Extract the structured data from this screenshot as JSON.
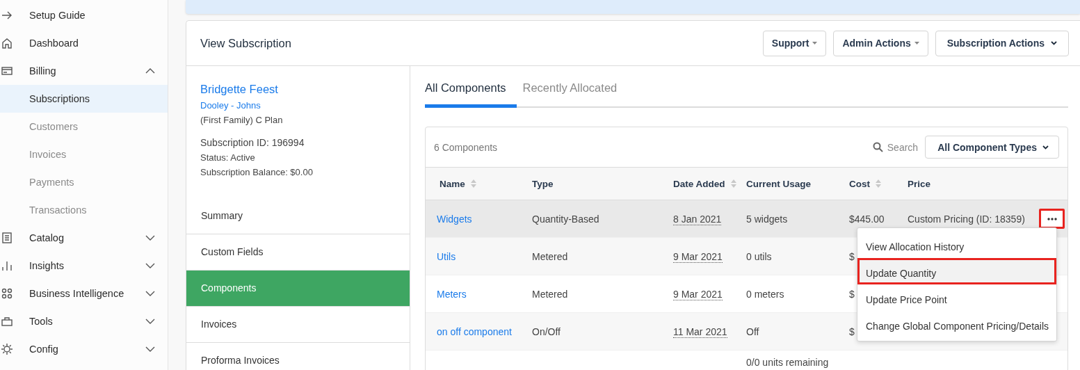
{
  "sidebar": {
    "items": [
      {
        "label": "Setup Guide"
      },
      {
        "label": "Dashboard"
      },
      {
        "label": "Billing",
        "expanded": true,
        "children": [
          {
            "label": "Subscriptions",
            "selected": true
          },
          {
            "label": "Customers",
            "selected": false
          },
          {
            "label": "Invoices",
            "selected": false
          },
          {
            "label": "Payments",
            "selected": false
          },
          {
            "label": "Transactions",
            "selected": false
          }
        ]
      },
      {
        "label": "Catalog",
        "expanded": false
      },
      {
        "label": "Insights",
        "expanded": false
      },
      {
        "label": "Business Intelligence",
        "expanded": false
      },
      {
        "label": "Tools",
        "expanded": false
      },
      {
        "label": "Config",
        "expanded": false
      }
    ]
  },
  "page": {
    "title": "View Subscription",
    "buttons": [
      "Support",
      "Admin Actions",
      "Subscription Actions"
    ]
  },
  "customer": {
    "name": "Bridgette Feest",
    "company": "Dooley - Johns",
    "plan": "(First Family) C Plan",
    "subscription_id": "Subscription ID: 196994",
    "status": "Status: Active",
    "balance": "Subscription Balance: $0.00"
  },
  "subscription_nav": [
    {
      "label": "Summary",
      "selected": false
    },
    {
      "label": "Custom Fields",
      "selected": false
    },
    {
      "label": "Components",
      "selected": true
    },
    {
      "label": "Invoices",
      "selected": false
    },
    {
      "label": "Proforma Invoices",
      "selected": false
    }
  ],
  "tabs": [
    {
      "label": "All Components",
      "selected": true
    },
    {
      "label": "Recently Allocated",
      "selected": false
    }
  ],
  "components": {
    "count": "6 Components",
    "search": "Search",
    "filter": "All Component Types",
    "columns": [
      {
        "label": "Name",
        "sortable": true
      },
      {
        "label": "Type",
        "sortable": false
      },
      {
        "label": "Date Added",
        "sortable": true
      },
      {
        "label": "Current Usage",
        "sortable": false
      },
      {
        "label": "Cost",
        "sortable": true
      },
      {
        "label": "Price",
        "sortable": false
      }
    ],
    "rows": [
      {
        "name": "Widgets",
        "type": "Quantity-Based",
        "date_added": "8 Jan 2021",
        "current_usage": "5 widgets",
        "cost": "$445.00",
        "price": "Custom Pricing (ID: 18359)",
        "highlighted": true,
        "menu_button": {
          "annotated": true
        }
      },
      {
        "name": "Utils",
        "type": "Metered",
        "date_added": "9 Mar 2021",
        "current_usage": "0 utils",
        "cost": "$",
        "highlighted": false
      },
      {
        "name": "Meters",
        "type": "Metered",
        "date_added": "9 Mar 2021",
        "current_usage": "0 meters",
        "cost": "$",
        "highlighted": false
      },
      {
        "name": "on off component",
        "type": "On/Off",
        "date_added": "11 Mar 2021",
        "current_usage": "Off",
        "cost": "$",
        "highlighted": false
      },
      {
        "current_usage": "0/0 units remaining",
        "highlighted": false
      }
    ]
  },
  "action_menu": {
    "items": [
      {
        "label": "View Allocation History",
        "hovered": false,
        "annotated": false
      },
      {
        "label": "Update Quantity",
        "hovered": true,
        "annotated": true
      },
      {
        "label": "Update Price Point",
        "hovered": false,
        "annotated": false
      },
      {
        "label": "Change Global Component Pricing/Details",
        "hovered": false,
        "annotated": false
      }
    ]
  }
}
